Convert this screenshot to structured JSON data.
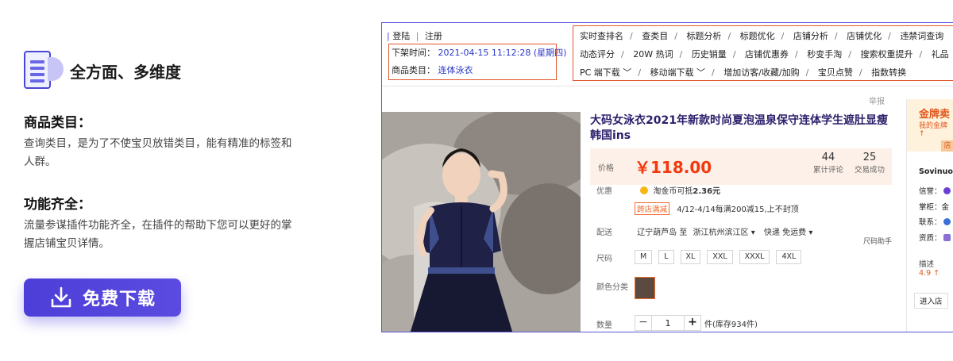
{
  "feature": {
    "title": "全方面、多维度",
    "icon": "document-list-icon"
  },
  "sections": [
    {
      "title": "商品类目：",
      "desc": "查询类目，是为了不使宝贝放错类目，能有精准的标签和人群。"
    },
    {
      "title": "功能齐全：",
      "desc": "流量参谋插件功能齐全，在插件的帮助下您可以更好的掌握店铺宝贝详情。"
    }
  ],
  "download": {
    "label": "免费下载",
    "icon": "download-icon"
  },
  "screenshot": {
    "login": "登陆",
    "register": "注册",
    "offline_label": "下架时间：",
    "offline_value": "2021-04-15 11:12:28 (星期四)",
    "category_label": "商品类目：",
    "category_value": "连体泳衣",
    "menu_rows": [
      [
        "实时查排名",
        "查类目",
        "标题分析",
        "标题优化",
        "店铺分析",
        "店铺优化",
        "违禁词查询"
      ],
      [
        "动态评分",
        "20W 热词",
        "历史销量",
        "店铺优惠券",
        "秒变手淘",
        "搜索权重提升",
        "礼品"
      ],
      [
        "PC 端下载",
        "移动端下载",
        "增加访客/收藏/加购",
        "宝贝点赞",
        "指数转换"
      ]
    ],
    "report": "举报",
    "product_title": "大码女泳衣2021年新款时尚夏泡温泉保守连体学生遮肚显瘦韩国ins",
    "price_label": "价格",
    "price": "￥118.00",
    "reviews_count": "44",
    "reviews_label": "累计评论",
    "sales_count": "25",
    "sales_label": "交易成功",
    "promo_label": "优惠",
    "coin_text": "淘金币可抵",
    "coin_value": "2.36元",
    "cross_tag": "跨店满减",
    "cross_text": "4/12-4/14每满200减15,上不封顶",
    "ship_label": "配送",
    "ship_from": "辽宁葫芦岛 至",
    "ship_to": "浙江杭州滨江区",
    "ship_type": "快递 免运费",
    "size_helper": "尺码助手",
    "size_label": "尺码",
    "sizes": [
      "M",
      "L",
      "XL",
      "XXL",
      "XXXL",
      "4XL"
    ],
    "color_label": "颜色分类",
    "qty_label": "数量",
    "qty_value": "1",
    "stock_text": "件(库存934件)",
    "store": {
      "gold": "金牌卖",
      "gold_sub": "我的金牌↑",
      "btn": "店",
      "name": "Sovinuo",
      "credit": "信誉：",
      "margin": "掌柜：金",
      "contact": "联系：",
      "qualification": "资质：",
      "desc_label": "描述",
      "desc_score": "4.9 ↑",
      "enter": "进入店"
    }
  },
  "colors": {
    "accent": "#4c3ed8",
    "highlight_box": "#e0562b",
    "price": "#f4380e",
    "link": "#2a38c8"
  }
}
